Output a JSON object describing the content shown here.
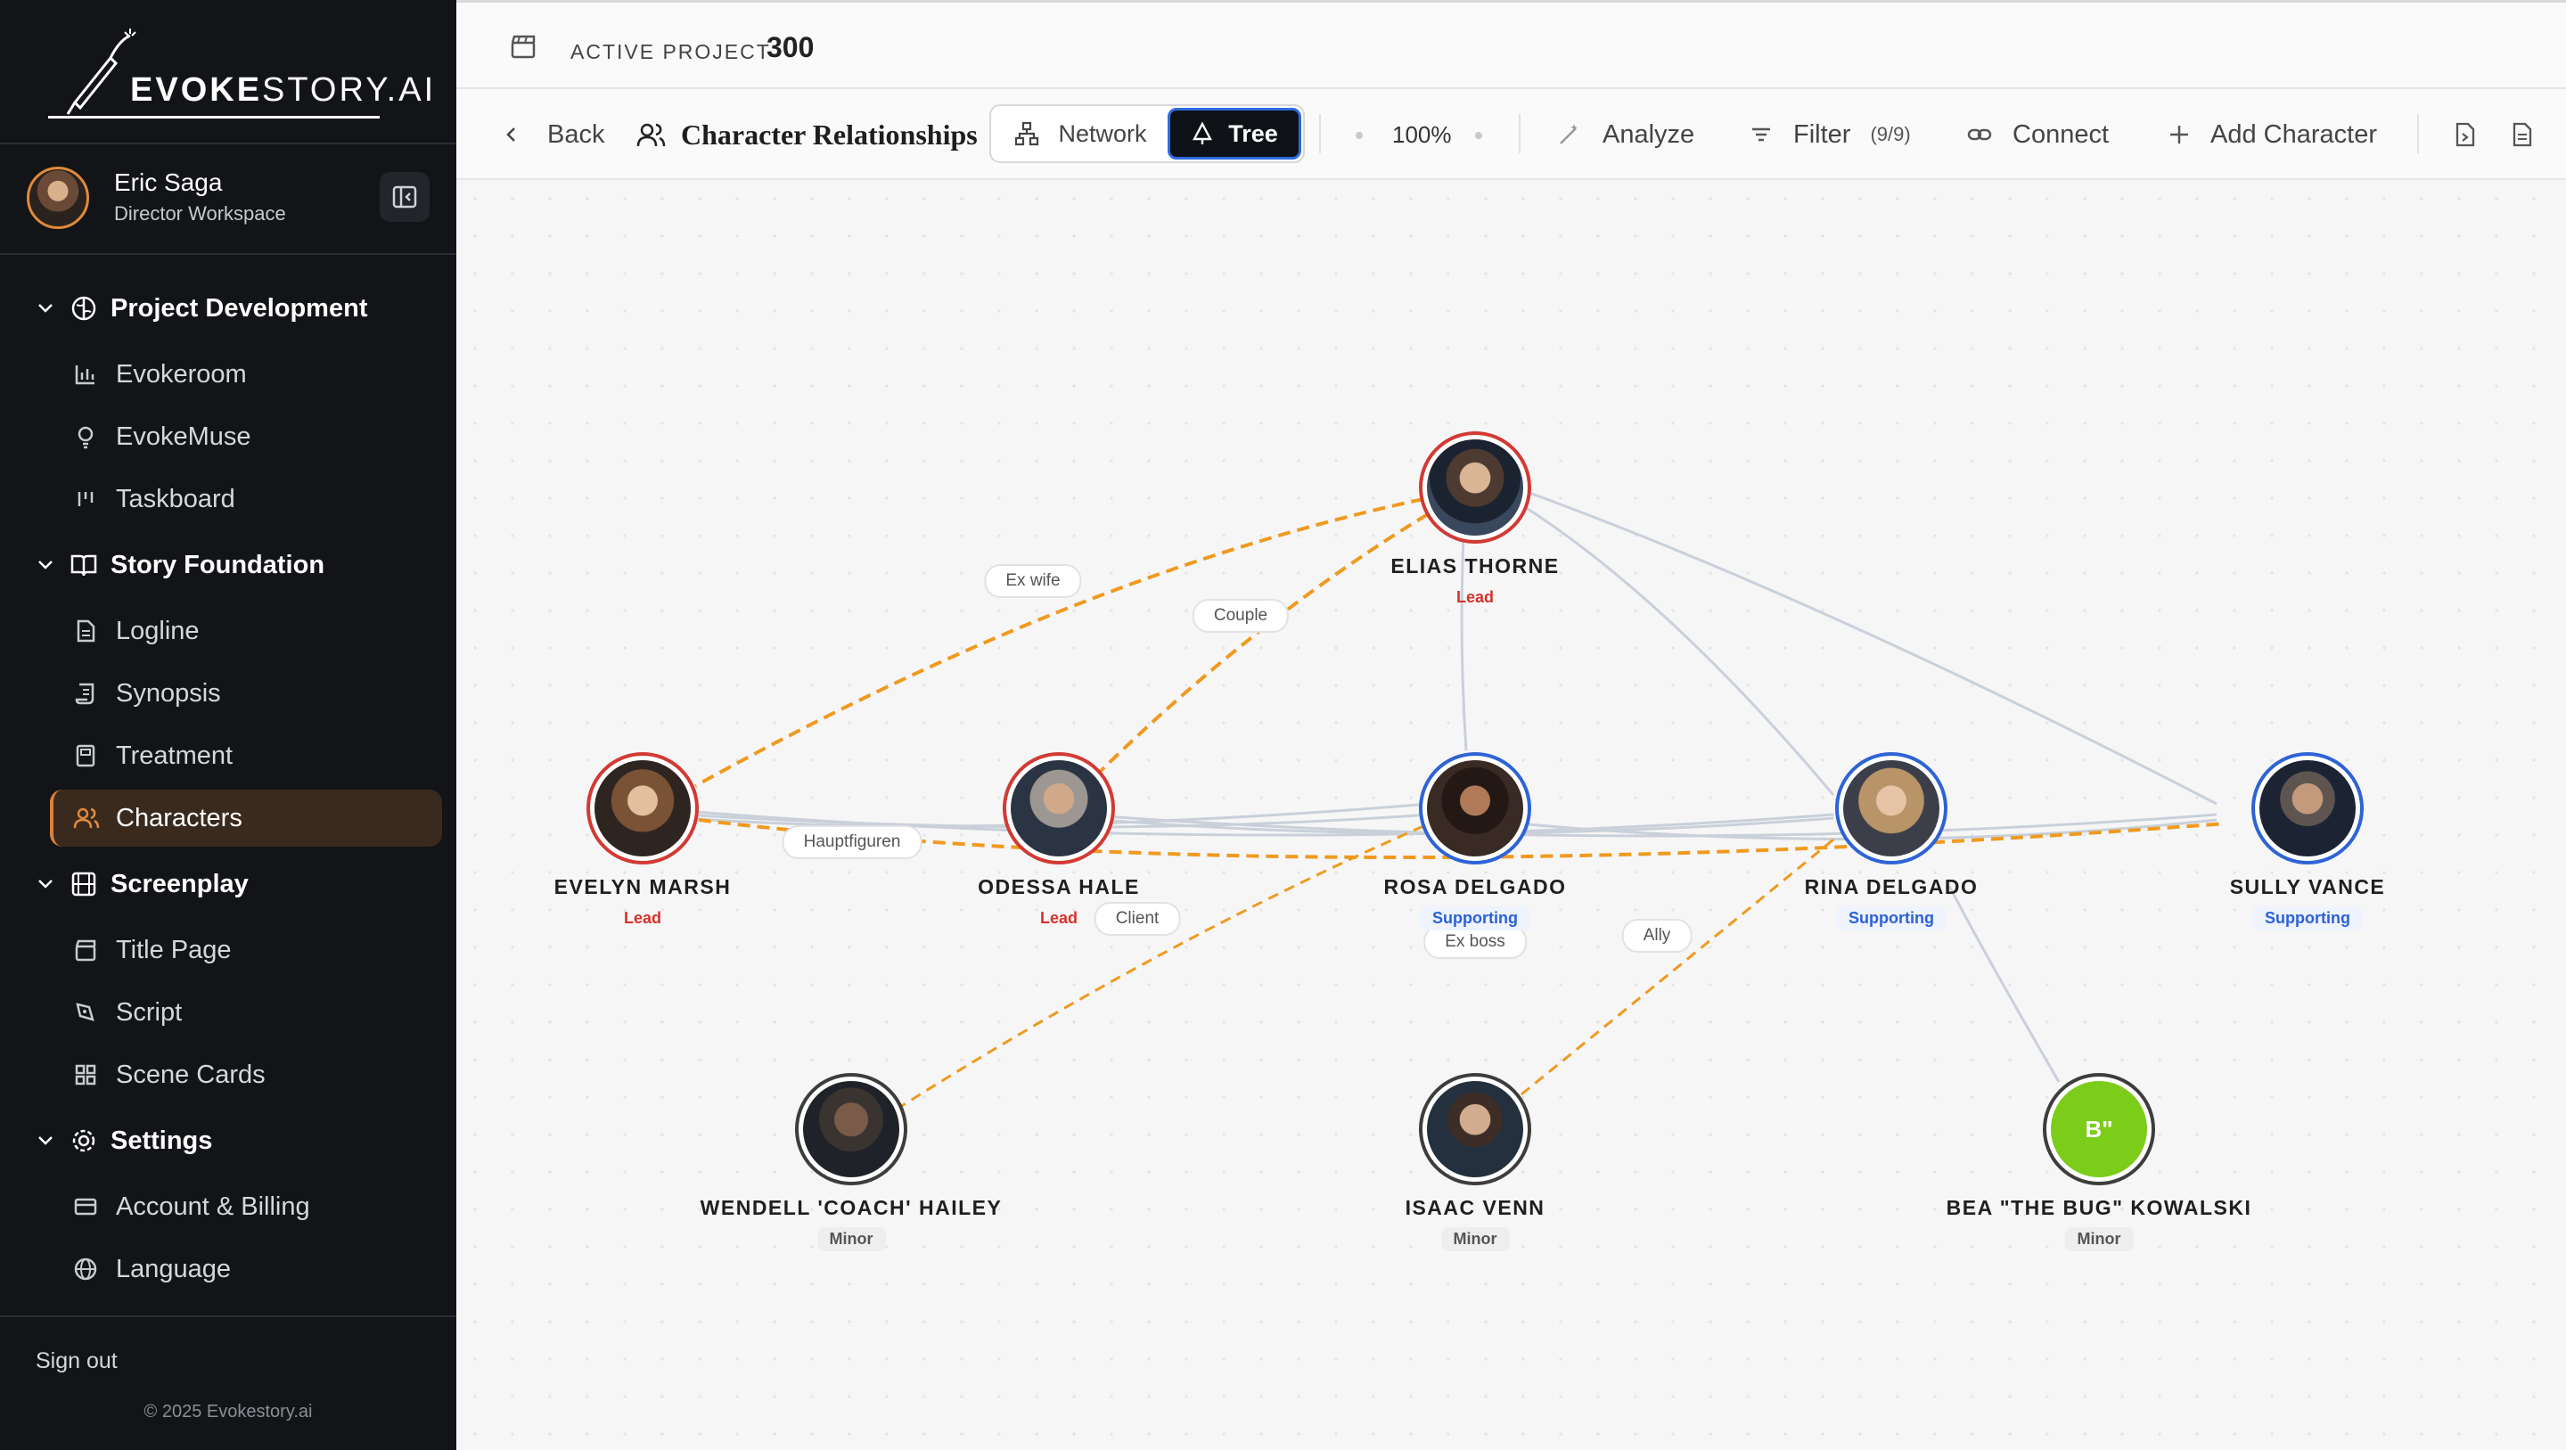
{
  "app": {
    "brand_bold": "EVOKE",
    "brand_rest": "STORY.AI"
  },
  "profile": {
    "name": "Eric Saga",
    "role": "Director Workspace"
  },
  "sidebar": {
    "sections": [
      {
        "label": "Project Development",
        "items": [
          "Evokeroom",
          "EvokeMuse",
          "Taskboard"
        ]
      },
      {
        "label": "Story Foundation",
        "items": [
          "Logline",
          "Synopsis",
          "Treatment",
          "Characters"
        ]
      },
      {
        "label": "Screenplay",
        "items": [
          "Title Page",
          "Script",
          "Scene Cards"
        ]
      },
      {
        "label": "Settings",
        "items": [
          "Account & Billing",
          "Language"
        ]
      }
    ],
    "active_item": "Characters",
    "sign_out": "Sign out",
    "copyright": "© 2025 Evokestory.ai"
  },
  "topbar": {
    "active_project_label": "ACTIVE PROJECT",
    "active_project_value": "300"
  },
  "toolbar": {
    "back": "Back",
    "title": "Character Relationships",
    "view_network": "Network",
    "view_tree": "Tree",
    "selected_view": "Tree",
    "zoom": "100%",
    "analyze": "Analyze",
    "filter": "Filter",
    "filter_count": "(9/9)",
    "connect": "Connect",
    "add_character": "Add Character"
  },
  "graph": {
    "nodes": [
      {
        "id": "elias",
        "name": "ELIAS THORNE",
        "role": "Lead"
      },
      {
        "id": "evelyn",
        "name": "EVELYN MARSH",
        "role": "Lead"
      },
      {
        "id": "odessa",
        "name": "ODESSA HALE",
        "role": "Lead"
      },
      {
        "id": "rosa",
        "name": "ROSA DELGADO",
        "role": "Supporting"
      },
      {
        "id": "rina",
        "name": "RINA DELGADO",
        "role": "Supporting"
      },
      {
        "id": "sully",
        "name": "SULLY VANCE",
        "role": "Supporting"
      },
      {
        "id": "wendell",
        "name": "WENDELL 'COACH' HAILEY",
        "role": "Minor"
      },
      {
        "id": "isaac",
        "name": "ISAAC VENN",
        "role": "Minor"
      },
      {
        "id": "bea",
        "name": "BEA \"THE BUG\" KOWALSKI",
        "role": "Minor",
        "initials": "B\""
      }
    ],
    "edge_labels": {
      "ex_wife": "Ex wife",
      "couple": "Couple",
      "hauptfiguren": "Hauptfiguren",
      "client": "Client",
      "ex_boss": "Ex boss",
      "ally": "Ally"
    },
    "colors": {
      "lead": "#d23a33",
      "supporting": "#2e63d6",
      "minor": "#3d3d3d",
      "dashed_edge": "#ef9a1f",
      "solid_edge": "#c9d0da",
      "accent": "#d9823b"
    }
  }
}
